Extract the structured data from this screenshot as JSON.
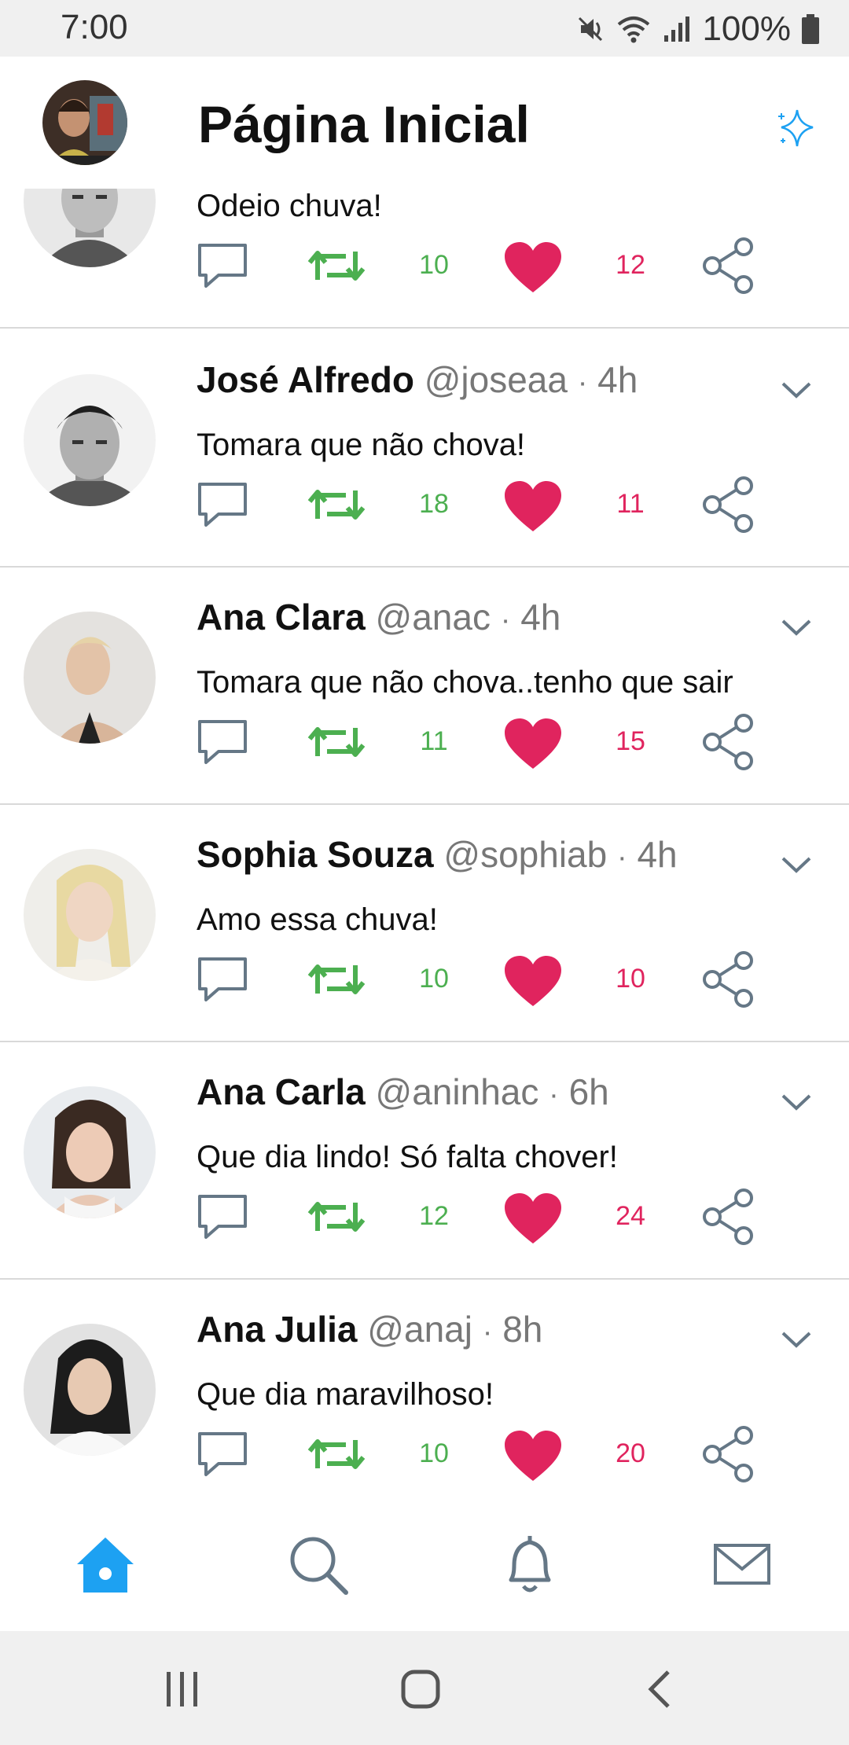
{
  "status_bar": {
    "time": "7:00",
    "battery": "100%",
    "icons": [
      "mute-icon",
      "wifi-icon",
      "signal-icon",
      "battery-icon"
    ]
  },
  "header": {
    "title": "Página Inicial",
    "avatar": "user-avatar",
    "action_icon": "sparkle-icon"
  },
  "colors": {
    "accent": "#1da1f2",
    "retweet": "#4caf50",
    "like": "#e0245e",
    "icon_gray": "#657786"
  },
  "tweets": [
    {
      "name": "",
      "handle": "",
      "time": "",
      "text": "Odeio chuva!",
      "retweets": "10",
      "likes": "12",
      "avatar": "avatar-man"
    },
    {
      "name": "José Alfredo",
      "handle": "@joseaa",
      "time": "4h",
      "text": "Tomara que não chova!",
      "retweets": "18",
      "likes": "11",
      "avatar": "avatar-man"
    },
    {
      "name": "Ana Clara",
      "handle": "@anac",
      "time": "4h",
      "text": "Tomara que não chova..tenho que sair",
      "retweets": "11",
      "likes": "15",
      "avatar": "avatar-woman"
    },
    {
      "name": "Sophia Souza",
      "handle": "@sophiab",
      "time": "4h",
      "text": "Amo essa chuva!",
      "retweets": "10",
      "likes": "10",
      "avatar": "avatar-woman"
    },
    {
      "name": "Ana Carla",
      "handle": "@aninhac",
      "time": "6h",
      "text": "Que dia lindo! Só falta chover!",
      "retweets": "12",
      "likes": "24",
      "avatar": "avatar-woman"
    },
    {
      "name": "Ana Julia",
      "handle": "@anaj",
      "time": "8h",
      "text": "Que dia maravilhoso!",
      "retweets": "10",
      "likes": "20",
      "avatar": "avatar-woman"
    }
  ],
  "bottom_nav": [
    "home-icon",
    "search-icon",
    "bell-icon",
    "mail-icon"
  ],
  "system_nav": [
    "recents-icon",
    "home-circle-icon",
    "back-icon"
  ]
}
